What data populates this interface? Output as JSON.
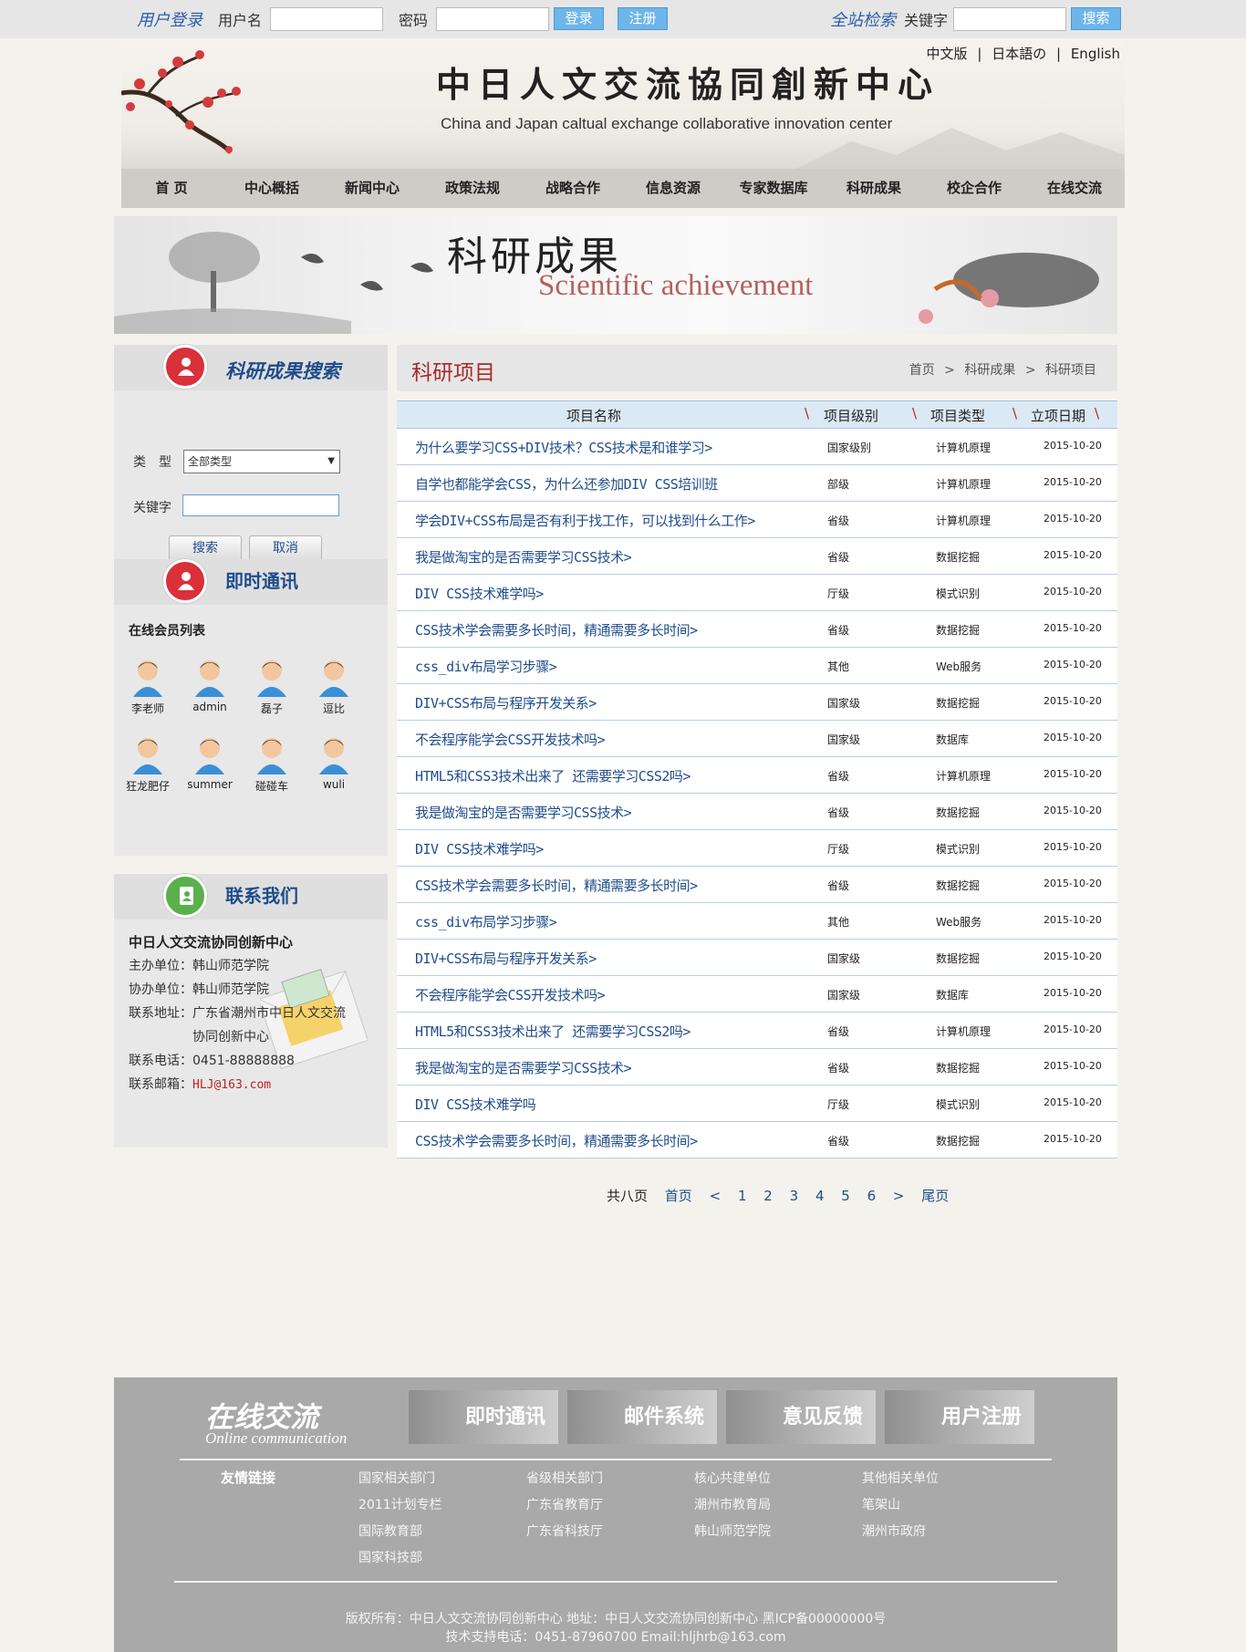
{
  "topbar": {
    "login_title": "用户登录",
    "username_label": "用户名",
    "password_label": "密码",
    "login_button": "登录",
    "register_button": "注册",
    "site_search_title": "全站检索",
    "keyword_label": "关键字",
    "search_button": "搜索"
  },
  "header": {
    "title_cn": "中日人文交流協同創新中心",
    "title_en": "China and Japan caltual exchange collaborative innovation center",
    "langs": [
      "中文版",
      "|",
      "日本語の",
      "|",
      "English"
    ]
  },
  "nav": [
    "首 页",
    "中心概括",
    "新闻中心",
    "政策法规",
    "战略合作",
    "信息资源",
    "专家数据库",
    "科研成果",
    "校企合作",
    "在线交流"
  ],
  "banner": {
    "title_cn": "科研成果",
    "title_en": "Scientific achievement"
  },
  "search_panel": {
    "title": "科研成果搜索",
    "type_label": "类　型",
    "type_selected": "全部类型",
    "keyword_label": "关键字",
    "search_button": "搜索",
    "cancel_button": "取消"
  },
  "chat_panel": {
    "title": "即时通讯",
    "subtitle": "在线会员列表",
    "members": [
      "李老师",
      "admin",
      "磊子",
      "逗比",
      "狂龙肥仔",
      "summer",
      "碰碰车",
      "wuli"
    ]
  },
  "contact_panel": {
    "title": "联系我们",
    "org": "中日人文交流协同创新中心",
    "host": "主办单位：韩山师范学院",
    "co_host": "协办单位：韩山师范学院",
    "address_1": "联系地址：广东省潮州市中日人文交流",
    "address_2": "协同创新中心",
    "phone": "联系电话：0451-88888888",
    "email_label": "联系邮箱：",
    "email": "HLJ@163.com"
  },
  "main": {
    "title": "科研项目",
    "breadcrumb": [
      "首页",
      ">",
      "科研成果",
      ">",
      "科研项目"
    ],
    "columns": [
      "项目名称",
      "项目级别",
      "项目类型",
      "立项日期"
    ],
    "rows": [
      {
        "name": "为什么要学习CSS+DIV技术？CSS技术是和谁学习>",
        "level": "国家级别",
        "type": "计算机原理",
        "date": "2015-10-20"
      },
      {
        "name": "自学也都能学会CSS，为什么还参加DIV CSS培训班",
        "level": "部级",
        "type": "计算机原理",
        "date": "2015-10-20"
      },
      {
        "name": "学会DIV+CSS布局是否有利于找工作，可以找到什么工作>",
        "level": "省级",
        "type": "计算机原理",
        "date": "2015-10-20"
      },
      {
        "name": "我是做淘宝的是否需要学习CSS技术>",
        "level": "省级",
        "type": "数据挖掘",
        "date": "2015-10-20"
      },
      {
        "name": "DIV CSS技术难学吗>",
        "level": "厅级",
        "type": "模式识别",
        "date": "2015-10-20"
      },
      {
        "name": "CSS技术学会需要多长时间，精通需要多长时间>",
        "level": "省级",
        "type": "数据挖掘",
        "date": "2015-10-20"
      },
      {
        "name": "css_div布局学习步骤>",
        "level": "其他",
        "type": "Web服务",
        "date": "2015-10-20"
      },
      {
        "name": "DIV+CSS布局与程序开发关系>",
        "level": "国家级",
        "type": "数据挖掘",
        "date": "2015-10-20"
      },
      {
        "name": "不会程序能学会CSS开发技术吗>",
        "level": "国家级",
        "type": "数据库",
        "date": "2015-10-20"
      },
      {
        "name": "HTML5和CSS3技术出来了 还需要学习CSS2吗>",
        "level": "省级",
        "type": "计算机原理",
        "date": "2015-10-20"
      },
      {
        "name": "我是做淘宝的是否需要学习CSS技术>",
        "level": "省级",
        "type": "数据挖掘",
        "date": "2015-10-20"
      },
      {
        "name": "DIV CSS技术难学吗>",
        "level": "厅级",
        "type": "模式识别",
        "date": "2015-10-20"
      },
      {
        "name": "CSS技术学会需要多长时间，精通需要多长时间>",
        "level": "省级",
        "type": "数据挖掘",
        "date": "2015-10-20"
      },
      {
        "name": "css_div布局学习步骤>",
        "level": "其他",
        "type": "Web服务",
        "date": "2015-10-20"
      },
      {
        "name": "DIV+CSS布局与程序开发关系>",
        "level": "国家级",
        "type": "数据挖掘",
        "date": "2015-10-20"
      },
      {
        "name": "不会程序能学会CSS开发技术吗>",
        "level": "国家级",
        "type": "数据库",
        "date": "2015-10-20"
      },
      {
        "name": "HTML5和CSS3技术出来了 还需要学习CSS2吗>",
        "level": "省级",
        "type": "计算机原理",
        "date": "2015-10-20"
      },
      {
        "name": "我是做淘宝的是否需要学习CSS技术>",
        "level": "省级",
        "type": "数据挖掘",
        "date": "2015-10-20"
      },
      {
        "name": "DIV CSS技术难学吗",
        "level": "厅级",
        "type": "模式识别",
        "date": "2015-10-20"
      },
      {
        "name": "CSS技术学会需要多长时间，精通需要多长时间>",
        "level": "省级",
        "type": "数据挖掘",
        "date": "2015-10-20"
      }
    ]
  },
  "pager": {
    "total": "共八页",
    "first": "首页",
    "prev": "<",
    "pages": [
      "1",
      "2",
      "3",
      "4",
      "5",
      "6"
    ],
    "next": ">",
    "last": "尾页"
  },
  "footer": {
    "online_cn": "在线交流",
    "online_en": "Online communication",
    "buttons": [
      "即时通讯",
      "邮件系统",
      "意见反馈",
      "用户注册"
    ],
    "links_label": "友情链接",
    "links": [
      [
        "国家相关部门",
        "2011计划专栏",
        "国际教育部",
        "国家科技部"
      ],
      [
        "省级相关部门",
        "广东省教育厅",
        "广东省科技厅"
      ],
      [
        "核心共建单位",
        "潮州市教育局",
        "韩山师范学院"
      ],
      [
        "其他相关单位",
        "笔架山",
        "潮州市政府"
      ]
    ],
    "copyright": "版权所有：中日人文交流协同创新中心 地址：中日人文交流协同创新中心 黑ICP备00000000号",
    "support": "技术支持电话：0451-87960700 Email:hljhrb@163.com"
  },
  "colors": {
    "accent_blue": "#1f4d8c",
    "title_red": "#a52a2a",
    "button_sky": "#6db5ea",
    "footer_gray": "#a9a9a9"
  }
}
